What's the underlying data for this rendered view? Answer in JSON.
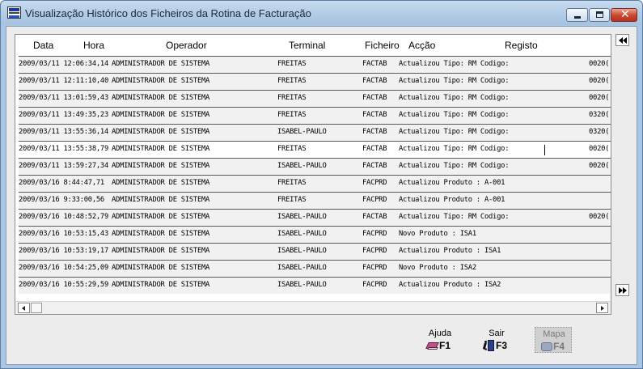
{
  "window": {
    "title": "Visualização Histórico dos Ficheiros da Rotina de Facturação",
    "close_glyph": "✕"
  },
  "grid": {
    "columns": [
      "Data",
      "Hora",
      "Operador",
      "Terminal",
      "Ficheiro",
      "Acção",
      "Registo"
    ],
    "rows": [
      {
        "datetime": "2009/03/11 12:06:34,14",
        "operador": "ADMINISTRADOR DE SISTEMA",
        "terminal": "FREITAS",
        "ficheiro": "FACTAB",
        "accao": "Actualizou Tipo: RM Codigo:",
        "registo": "0020("
      },
      {
        "datetime": "2009/03/11 12:11:10,40",
        "operador": "ADMINISTRADOR DE SISTEMA",
        "terminal": "FREITAS",
        "ficheiro": "FACTAB",
        "accao": "Actualizou Tipo: RM Codigo:",
        "registo": "0020("
      },
      {
        "datetime": "2009/03/11 13:01:59,43",
        "operador": "ADMINISTRADOR DE SISTEMA",
        "terminal": "FREITAS",
        "ficheiro": "FACTAB",
        "accao": "Actualizou Tipo: RM Codigo:",
        "registo": "0020("
      },
      {
        "datetime": "2009/03/11 13:49:35,23",
        "operador": "ADMINISTRADOR DE SISTEMA",
        "terminal": "FREITAS",
        "ficheiro": "FACTAB",
        "accao": "Actualizou Tipo: RM Codigo:",
        "registo": "0320("
      },
      {
        "datetime": "2009/03/11 13:55:36,14",
        "operador": "ADMINISTRADOR DE SISTEMA",
        "terminal": "ISABEL-PAULO",
        "ficheiro": "FACTAB",
        "accao": "Actualizou Tipo: RM Codigo:",
        "registo": "0320("
      },
      {
        "datetime": "2009/03/11 13:55:38,79",
        "operador": "ADMINISTRADOR DE SISTEMA",
        "terminal": "FREITAS",
        "ficheiro": "FACTAB",
        "accao": "Actualizou Tipo: RM Codigo:",
        "registo": "0020("
      },
      {
        "datetime": "2009/03/11 13:59:27,34",
        "operador": "ADMINISTRADOR DE SISTEMA",
        "terminal": "ISABEL-PAULO",
        "ficheiro": "FACTAB",
        "accao": "Actualizou Tipo: RM Codigo:",
        "registo": "0020("
      },
      {
        "datetime": "2009/03/16  8:44:47,71",
        "operador": "ADMINISTRADOR DE SISTEMA",
        "terminal": "FREITAS",
        "ficheiro": "FACPRD",
        "accao": "Actualizou Produto : A-001",
        "registo": ""
      },
      {
        "datetime": "2009/03/16  9:33:00,56",
        "operador": "ADMINISTRADOR DE SISTEMA",
        "terminal": "FREITAS",
        "ficheiro": "FACPRD",
        "accao": "Actualizou Produto : A-001",
        "registo": ""
      },
      {
        "datetime": "2009/03/16 10:48:52,79",
        "operador": "ADMINISTRADOR DE SISTEMA",
        "terminal": "ISABEL-PAULO",
        "ficheiro": "FACTAB",
        "accao": "Actualizou Tipo: RM Codigo:",
        "registo": "0020("
      },
      {
        "datetime": "2009/03/16 10:53:15,43",
        "operador": "ADMINISTRADOR DE SISTEMA",
        "terminal": "ISABEL-PAULO",
        "ficheiro": "FACPRD",
        "accao": "Novo       Produto : ISA1",
        "registo": ""
      },
      {
        "datetime": "2009/03/16 10:53:19,17",
        "operador": "ADMINISTRADOR DE SISTEMA",
        "terminal": "ISABEL-PAULO",
        "ficheiro": "FACPRD",
        "accao": "Actualizou Produto : ISA1",
        "registo": ""
      },
      {
        "datetime": "2009/03/16 10:54:25,09",
        "operador": "ADMINISTRADOR DE SISTEMA",
        "terminal": "ISABEL-PAULO",
        "ficheiro": "FACPRD",
        "accao": "Novo       Produto : ISA2",
        "registo": ""
      },
      {
        "datetime": "2009/03/16 10:55:29,59",
        "operador": "ADMINISTRADOR DE SISTEMA",
        "terminal": "ISABEL-PAULO",
        "ficheiro": "FACPRD",
        "accao": "Actualizou Produto : ISA2",
        "registo": ""
      }
    ],
    "selected_row": 5
  },
  "buttons": {
    "help": {
      "label": "Ajuda",
      "key": "F1",
      "icon": "book-icon"
    },
    "exit": {
      "label": "Sair",
      "key": "F3",
      "icon": "exit-door-icon"
    },
    "map": {
      "label": "Mapa",
      "key": "F4",
      "icon": "map-icon",
      "disabled": true
    }
  },
  "colors": {
    "title_bar": "#b4cde7",
    "row_background": "#f1f1f1",
    "selected_row": "#ffffff",
    "close_button": "#c8452e"
  }
}
